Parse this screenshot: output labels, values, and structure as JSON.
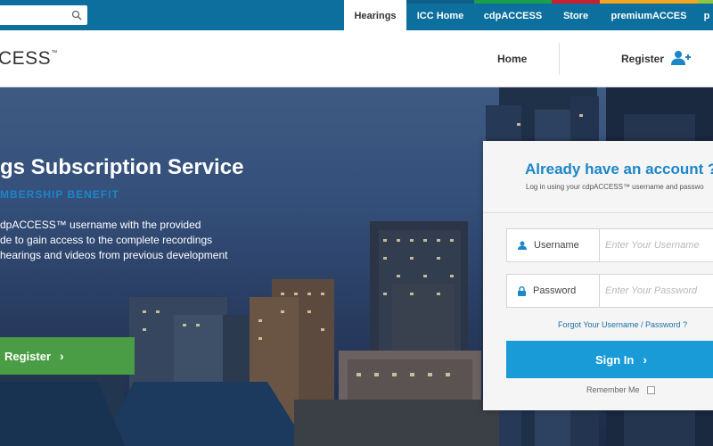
{
  "topbar": {
    "search": {
      "placeholder": "",
      "icon": "search-icon"
    },
    "tabs": [
      {
        "label": "Hearings",
        "active": true,
        "accent": "#ffffff"
      },
      {
        "label": "ICC Home",
        "active": false,
        "accent": "#0c5f88"
      },
      {
        "label": "cdpACCESS",
        "active": false,
        "accent": "#1b9e4b"
      },
      {
        "label": "Store",
        "active": false,
        "accent": "#c8202f"
      },
      {
        "label": "premiumACCES",
        "active": false,
        "accent": "#f2a51f"
      },
      {
        "label": "p",
        "active": false,
        "accent": "#8dc63f"
      }
    ]
  },
  "header": {
    "logo_text": "CESS",
    "logo_mark": "™",
    "nav_home": "Home",
    "nav_register": "Register",
    "register_icon": "add-user-icon"
  },
  "hero": {
    "title": "gs Subscription Service",
    "subtitle": "MBERSHIP BENEFIT",
    "description": [
      "dpACCESS™ username with the provided",
      "de to gain access to the complete recordings",
      "hearings and videos from previous development"
    ],
    "button_label": "Register",
    "button_icon": "chevron-right-icon"
  },
  "login": {
    "title": "Already have an account ?",
    "hint": "Log in using your cdpACCESS™ username and passwo",
    "username_label": "Username",
    "username_placeholder": "Enter Your Username",
    "username_icon": "user-icon",
    "password_label": "Password",
    "password_placeholder": "Enter Your Password",
    "password_icon": "lock-icon",
    "forgot_link": "Forgot Your Username / Password ?",
    "signin_label": "Sign In",
    "remember_label": "Remember Me"
  },
  "colors": {
    "topbar": "#0d6f9e",
    "brand_blue": "#1b86c8",
    "signin_button": "#189bd7",
    "register_button": "#4a9d45"
  }
}
